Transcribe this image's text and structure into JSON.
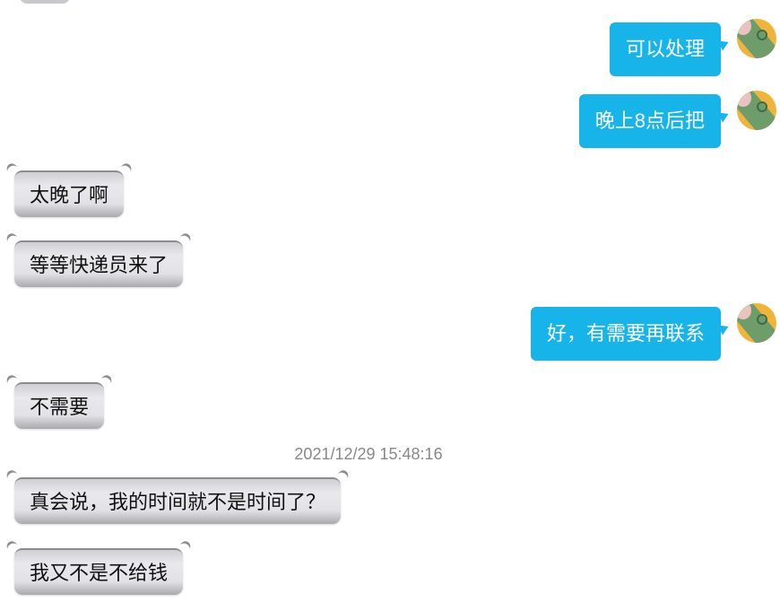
{
  "messages": [
    {
      "dir": "out",
      "text": "可以处理"
    },
    {
      "dir": "out",
      "text": "晚上8点后把"
    },
    {
      "dir": "in",
      "text": "太晚了啊"
    },
    {
      "dir": "in",
      "text": "等等快递员来了"
    },
    {
      "dir": "out",
      "text": "好，有需要再联系"
    },
    {
      "dir": "in",
      "text": "不需要"
    },
    {
      "dir": "in",
      "text": "真会说，我的时间就不是时间了？"
    },
    {
      "dir": "in",
      "text": "我又不是不给钱"
    }
  ],
  "timestamp": "2021/12/29 15:48:16",
  "colors": {
    "outgoing_bubble": "#17b4ea",
    "incoming_bubble": "#e2e2e6",
    "timestamp_text": "#888888"
  },
  "icons": {
    "avatar": "user-avatar-icon"
  }
}
